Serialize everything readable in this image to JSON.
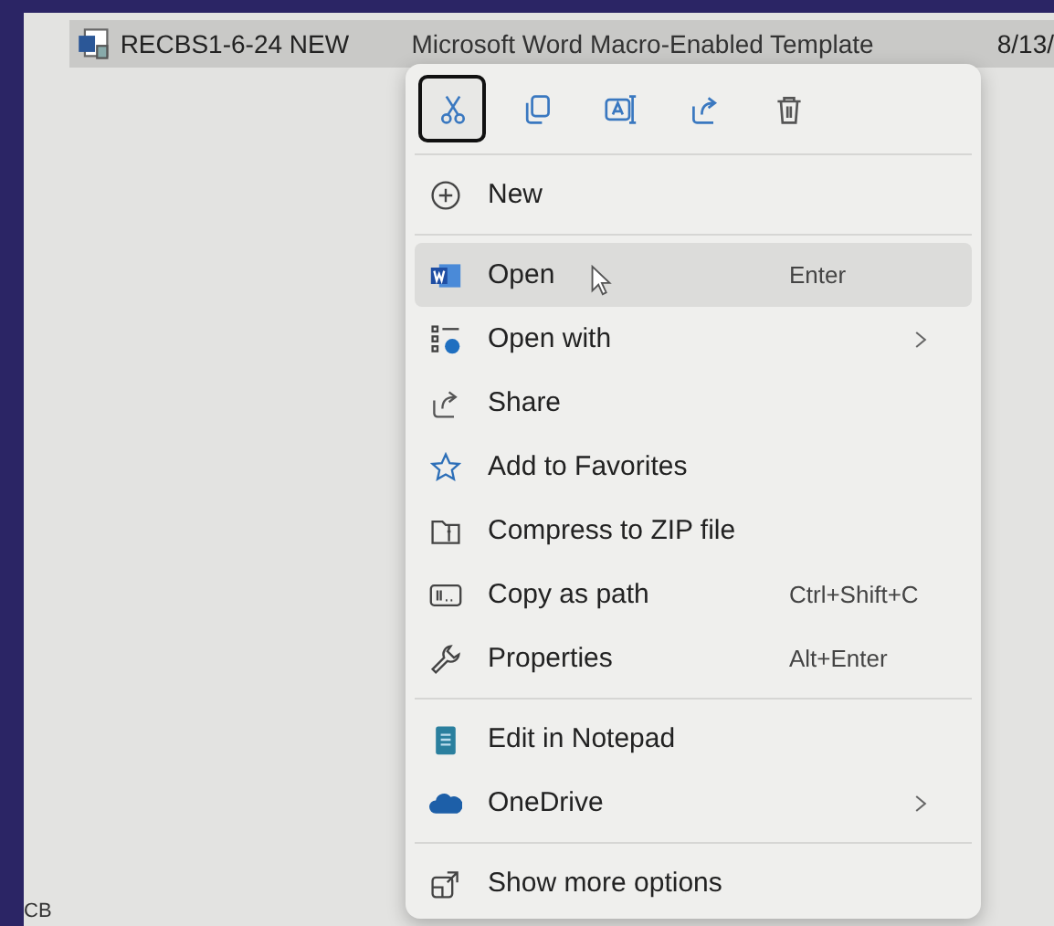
{
  "file_row": {
    "name": "RECBS1-6-24 NEW",
    "type": "Microsoft Word Macro-Enabled Template",
    "date": "8/13/",
    "selected": true
  },
  "toolbar": [
    {
      "selected": true
    },
    {
      "selected": false
    },
    {
      "selected": false
    },
    {
      "selected": false
    },
    {
      "selected": false
    }
  ],
  "menu_groups": [
    [
      {
        "label": "New",
        "submenu": false,
        "selected": false
      }
    ],
    [
      {
        "label": "Open",
        "shortcut": "Enter",
        "submenu": false,
        "selected": true
      },
      {
        "label": "Open with",
        "submenu": true,
        "selected": false
      },
      {
        "label": "Share",
        "submenu": false,
        "selected": false
      },
      {
        "label": "Add to Favorites",
        "submenu": false,
        "selected": false
      },
      {
        "label": "Compress to ZIP file",
        "submenu": false,
        "selected": false
      },
      {
        "label": "Copy as path",
        "shortcut": "Ctrl+Shift+C",
        "submenu": false,
        "selected": false
      },
      {
        "label": "Properties",
        "shortcut": "Alt+Enter",
        "submenu": false,
        "selected": false
      }
    ],
    [
      {
        "label": "Edit in Notepad",
        "submenu": false,
        "selected": false
      },
      {
        "label": "OneDrive",
        "submenu": true,
        "selected": false
      }
    ],
    [
      {
        "label": "Show more options",
        "submenu": false,
        "selected": false
      }
    ]
  ],
  "status_text": "CB"
}
